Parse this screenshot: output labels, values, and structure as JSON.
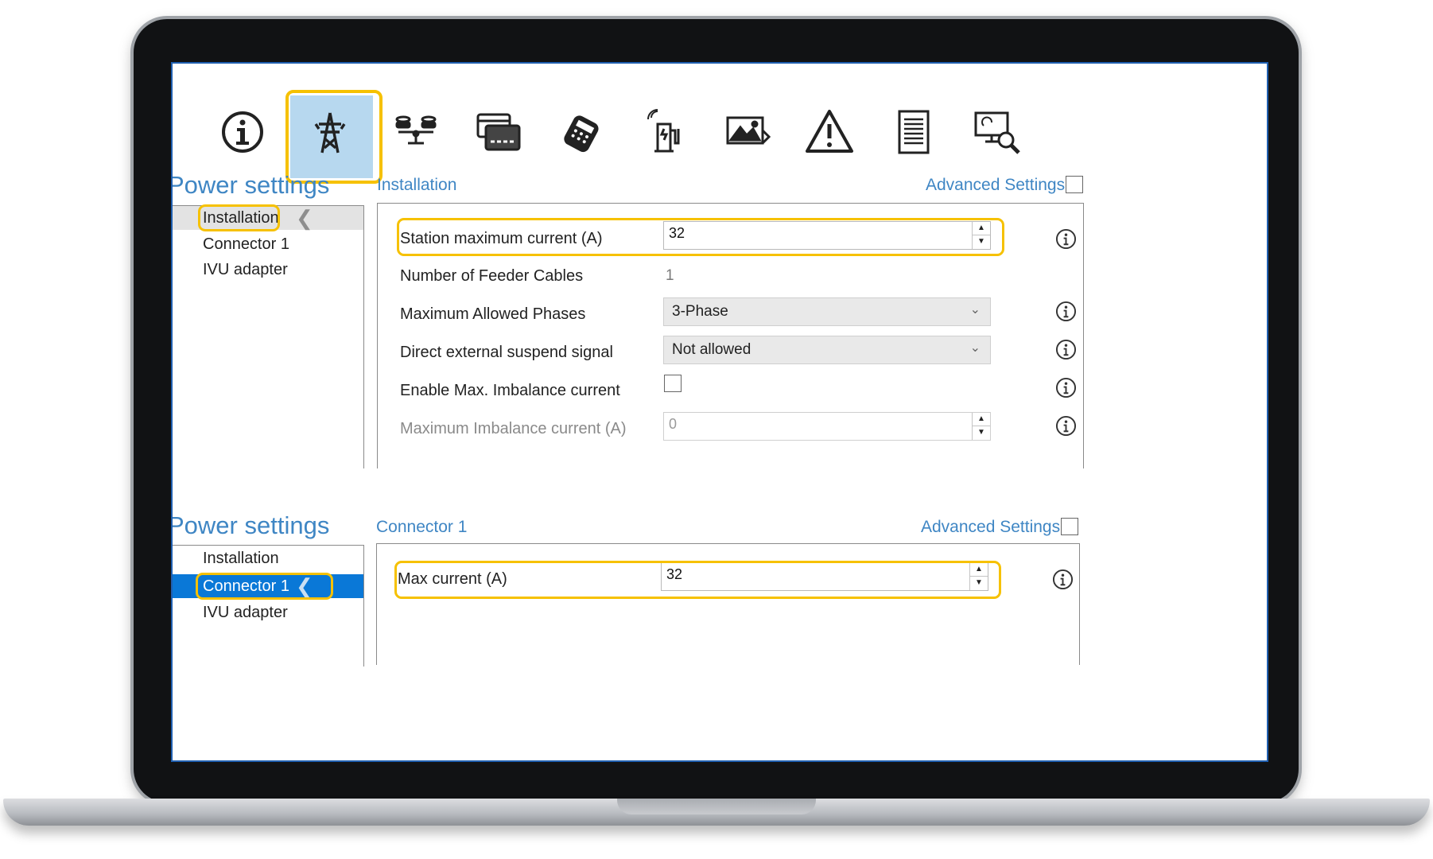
{
  "toolbar": {
    "icons": [
      "info-icon",
      "power-pylon-icon",
      "load-balance-icon",
      "card-reader-icon",
      "payment-terminal-icon",
      "charging-station-icon",
      "display-image-icon",
      "warning-icon",
      "document-icon",
      "diagnostics-icon"
    ],
    "selected": "power-pylon-icon"
  },
  "installation_view": {
    "panel_title": "Power settings",
    "nav": [
      "Installation",
      "Connector 1",
      "IVU adapter"
    ],
    "selected_nav": "Installation",
    "section_title": "Installation",
    "advanced_settings_label": "Advanced Settings",
    "fields": {
      "station_max_current": {
        "label": "Station maximum current (A)",
        "value": "32"
      },
      "feeder_cables": {
        "label": "Number of Feeder Cables",
        "value": "1"
      },
      "max_phases": {
        "label": "Maximum Allowed Phases",
        "value": "3-Phase"
      },
      "suspend_signal": {
        "label": "Direct external suspend signal",
        "value": "Not allowed"
      },
      "enable_imbalance": {
        "label": "Enable Max. Imbalance current",
        "checked": false
      },
      "max_imbalance": {
        "label": "Maximum Imbalance current (A)",
        "value": "0"
      }
    }
  },
  "connector_view": {
    "panel_title": "Power settings",
    "nav": [
      "Installation",
      "Connector 1",
      "IVU adapter"
    ],
    "selected_nav": "Connector 1",
    "section_title": "Connector 1",
    "advanced_settings_label": "Advanced Settings",
    "fields": {
      "max_current": {
        "label": "Max current (A)",
        "value": "32"
      }
    }
  },
  "colors": {
    "highlight": "#f6c100",
    "accent": "#3f86c4",
    "selection": "#0a78d7",
    "selected_tool_bg": "#b7d8ef"
  }
}
